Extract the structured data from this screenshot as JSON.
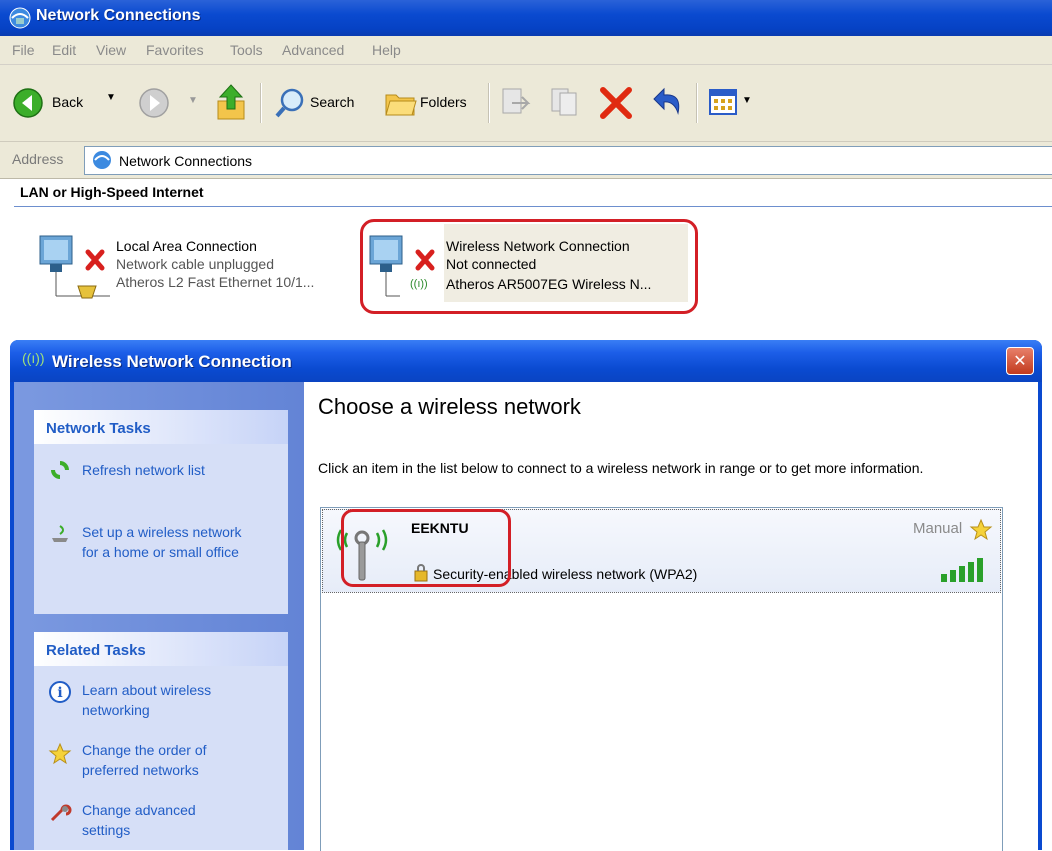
{
  "window": {
    "title": "Network Connections"
  },
  "menu": [
    "File",
    "Edit",
    "View",
    "Favorites",
    "Tools",
    "Advanced",
    "Help"
  ],
  "toolbar": {
    "back": "Back",
    "search": "Search",
    "folders": "Folders"
  },
  "address": {
    "label": "Address",
    "value": "Network Connections"
  },
  "section": {
    "title": "LAN or High-Speed Internet"
  },
  "connections": [
    {
      "name": "Local Area Connection",
      "status": "Network cable unplugged",
      "device": "Atheros L2 Fast Ethernet 10/1..."
    },
    {
      "name": "Wireless Network Connection",
      "status": "Not connected",
      "device": "Atheros AR5007EG Wireless N..."
    }
  ],
  "dialog": {
    "title": "Wireless Network Connection",
    "network_tasks": {
      "title": "Network Tasks",
      "items": [
        "Refresh network list",
        "Set up a wireless network\nfor a home or small office"
      ]
    },
    "related_tasks": {
      "title": "Related Tasks",
      "items": [
        "Learn about wireless\nnetworking",
        "Change the order of\npreferred networks",
        "Change advanced\nsettings"
      ]
    },
    "heading": "Choose a wireless network",
    "description": "Click an item in the list below to connect to a wireless network in range or to get more information.",
    "network": {
      "ssid": "EEKNTU",
      "mode": "Manual",
      "security": "Security-enabled wireless network (WPA2)"
    }
  },
  "colors": {
    "accent": "#215dc6",
    "highlight": "#d31f26",
    "titlebar": "#0a4ad0"
  }
}
